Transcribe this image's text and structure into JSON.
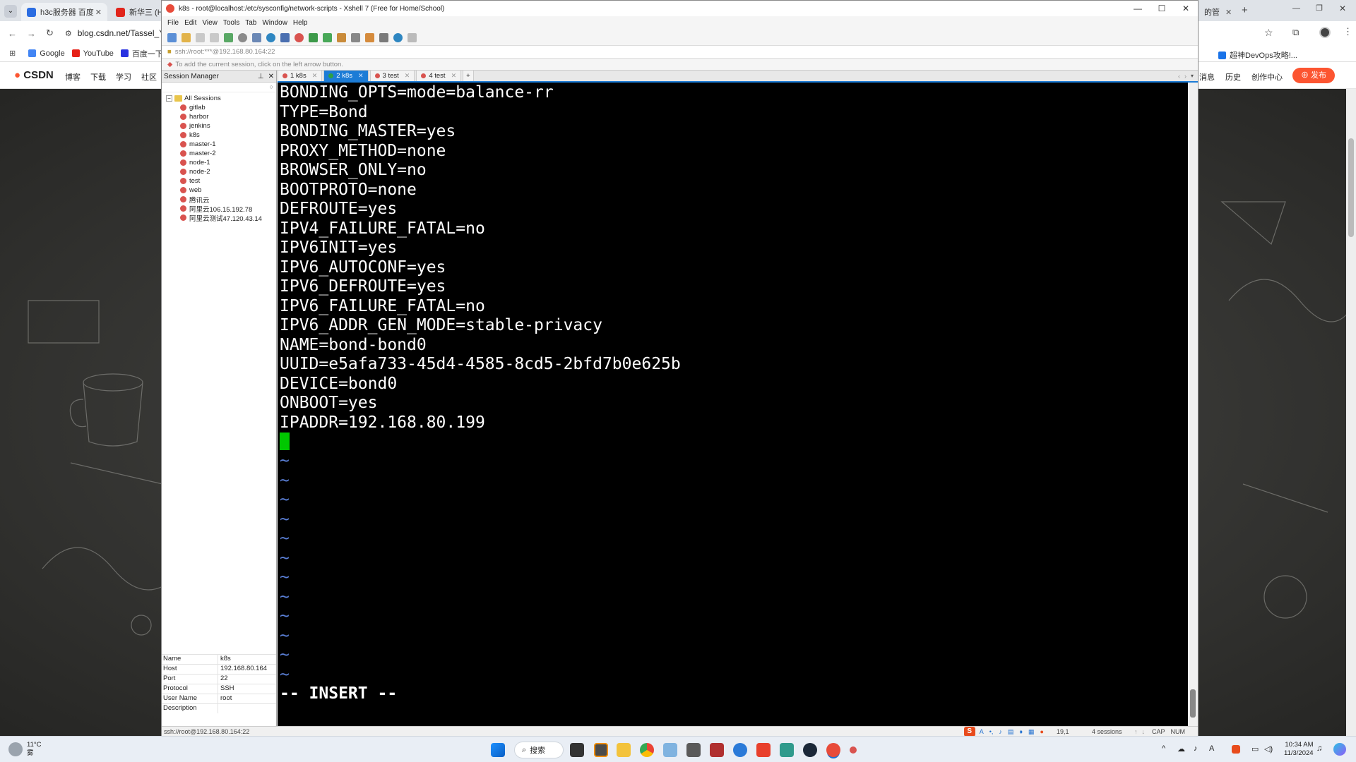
{
  "browser": {
    "tabs": [
      {
        "title": "h3c服务器 百度",
        "icon_color": "#2b6de1"
      },
      {
        "title": "新华三 (H3",
        "icon_color": "#e1251b"
      },
      {
        "title": "的管",
        "icon_color": "#2b6de1"
      }
    ],
    "address": "blog.csdn.net/Tassel_Y",
    "bookmarks": [
      {
        "label": "Google",
        "icon": "google-icon",
        "color": "#4285f4"
      },
      {
        "label": "YouTube",
        "icon": "youtube-icon",
        "color": "#e62117"
      },
      {
        "label": "百度一下",
        "icon": "baidu-icon",
        "color": "#2932e1"
      }
    ],
    "right_bookmark": "超神DevOps攻略!...",
    "nav": {
      "logo": "CSDN",
      "items": [
        "博客",
        "下载",
        "学习",
        "社区"
      ],
      "right_items": [
        "消息",
        "历史",
        "创作中心"
      ],
      "publish_label": "发布"
    }
  },
  "xshell": {
    "title": "k8s - root@localhost:/etc/sysconfig/network-scripts - Xshell 7 (Free for Home/School)",
    "menu": [
      "File",
      "Edit",
      "View",
      "Tools",
      "Tab",
      "Window",
      "Help"
    ],
    "address_text": "ssh://root:***@192.168.80.164:22",
    "hint_text": "To add the current session, click on the left arrow button.",
    "session_manager": {
      "title": "Session Manager",
      "root": "All Sessions",
      "sessions": [
        "gitlab",
        "harbor",
        "jenkins",
        "k8s",
        "master-1",
        "master-2",
        "node-1",
        "node-2",
        "test",
        "web",
        "腾讯云",
        "阿里云106.15.192.78",
        "阿里云测试47.120.43.14"
      ]
    },
    "properties": [
      {
        "key": "Name",
        "value": "k8s"
      },
      {
        "key": "Host",
        "value": "192.168.80.164"
      },
      {
        "key": "Port",
        "value": "22"
      },
      {
        "key": "Protocol",
        "value": "SSH"
      },
      {
        "key": "User Name",
        "value": "root"
      },
      {
        "key": "Description",
        "value": ""
      }
    ],
    "tabs": [
      {
        "label": "1 k8s",
        "active": false
      },
      {
        "label": "2 k8s",
        "active": true
      },
      {
        "label": "3 test",
        "active": false
      },
      {
        "label": "4 test",
        "active": false
      }
    ],
    "terminal_lines": [
      "BONDING_OPTS=mode=balance-rr",
      "TYPE=Bond",
      "BONDING_MASTER=yes",
      "PROXY_METHOD=none",
      "BROWSER_ONLY=no",
      "BOOTPROTO=none",
      "DEFROUTE=yes",
      "IPV4_FAILURE_FATAL=no",
      "IPV6INIT=yes",
      "IPV6_AUTOCONF=yes",
      "IPV6_DEFROUTE=yes",
      "IPV6_FAILURE_FATAL=no",
      "IPV6_ADDR_GEN_MODE=stable-privacy",
      "NAME=bond-bond0",
      "UUID=e5afa733-45d4-4585-8cd5-2bfd7b0e625b",
      "DEVICE=bond0",
      "ONBOOT=yes",
      "IPADDR=192.168.80.199"
    ],
    "tilde": "~",
    "tilde_count": 12,
    "mode_line": "-- INSERT --",
    "status": {
      "left": "ssh://root@192.168.80.164:22",
      "position": "19,1",
      "sessions": "4 sessions",
      "caps": "CAP",
      "num": "NUM"
    }
  },
  "taskbar": {
    "weather_temp": "11°C",
    "weather_desc": "雾",
    "search_label": "搜索",
    "time": "10:34 AM",
    "date": "11/3/2024"
  }
}
